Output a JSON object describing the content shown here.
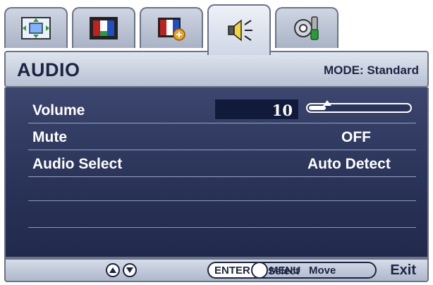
{
  "tabs": [
    {
      "name": "display-settings",
      "icon": "picture-adjust-icon"
    },
    {
      "name": "picture",
      "icon": "color-bars-icon"
    },
    {
      "name": "picture-advanced",
      "icon": "color-bars-plus-icon"
    },
    {
      "name": "audio",
      "icon": "speaker-icon"
    },
    {
      "name": "system",
      "icon": "system-settings-icon"
    }
  ],
  "active_tab": 3,
  "header": {
    "title": "AUDIO",
    "mode": "MODE: Standard"
  },
  "settings": {
    "volume": {
      "label": "Volume",
      "value": "10",
      "level": 0.1
    },
    "mute": {
      "label": "Mute",
      "value": "OFF"
    },
    "audio_select": {
      "label": "Audio Select",
      "value": "Auto Detect"
    }
  },
  "footer": {
    "enter_label": "ENTER",
    "select_label": "Select",
    "menu_label": "MENU",
    "move_label": "Move",
    "exit_label": "Exit"
  },
  "colors": {
    "panel_bg": "#2a3358",
    "header_text": "#1c2443",
    "row_text": "#ffffff"
  }
}
